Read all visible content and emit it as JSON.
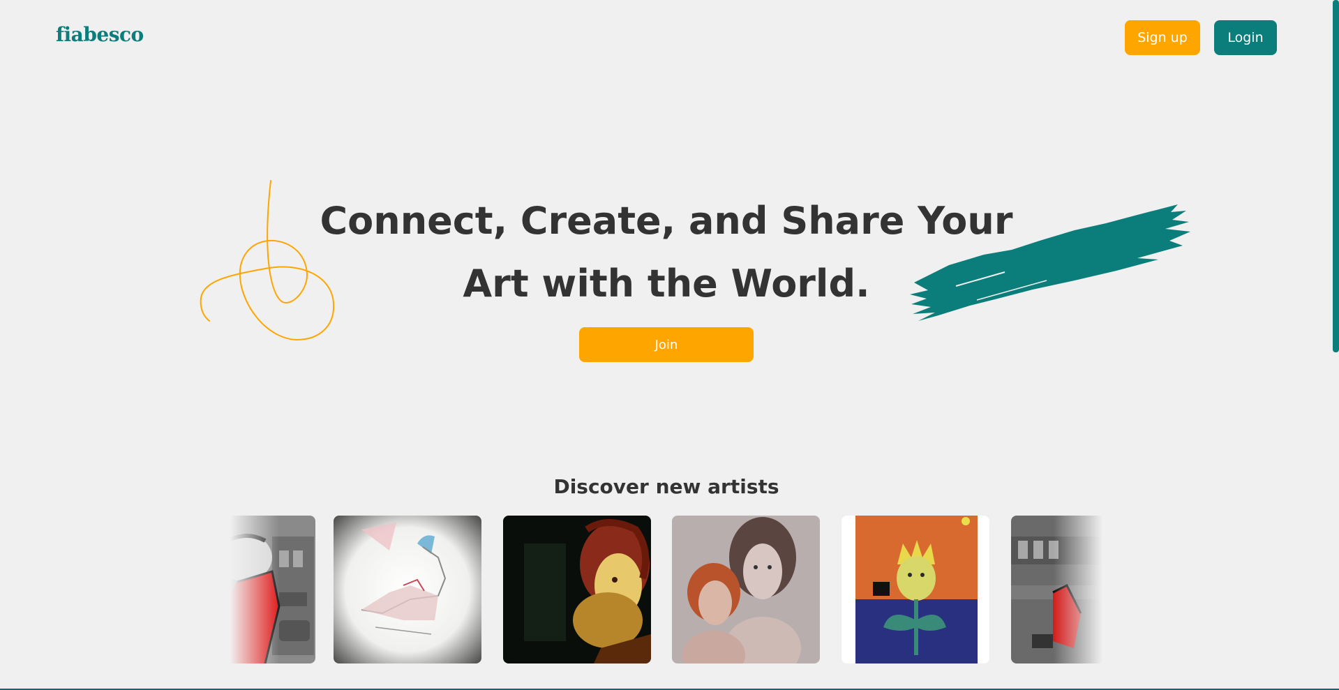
{
  "header": {
    "logo": "fiabesco",
    "signup_label": "Sign up",
    "login_label": "Login"
  },
  "hero": {
    "title": "Connect, Create, and Share Your Art with the World.",
    "join_label": "Join"
  },
  "discover": {
    "heading": "Discover new artists",
    "artworks": [
      {
        "name": "artwork-red-figure",
        "icon": "artwork-thumbnail"
      },
      {
        "name": "artwork-pink-sketch",
        "icon": "artwork-thumbnail"
      },
      {
        "name": "artwork-dark-portrait",
        "icon": "artwork-thumbnail"
      },
      {
        "name": "artwork-two-women",
        "icon": "artwork-thumbnail"
      },
      {
        "name": "artwork-flower-face",
        "icon": "artwork-thumbnail"
      },
      {
        "name": "artwork-shelf-figure",
        "icon": "artwork-thumbnail"
      }
    ]
  },
  "colors": {
    "brand_teal": "#0b7e7b",
    "accent_orange": "#ffa500",
    "background": "#f0f0f0",
    "text": "#333333"
  }
}
